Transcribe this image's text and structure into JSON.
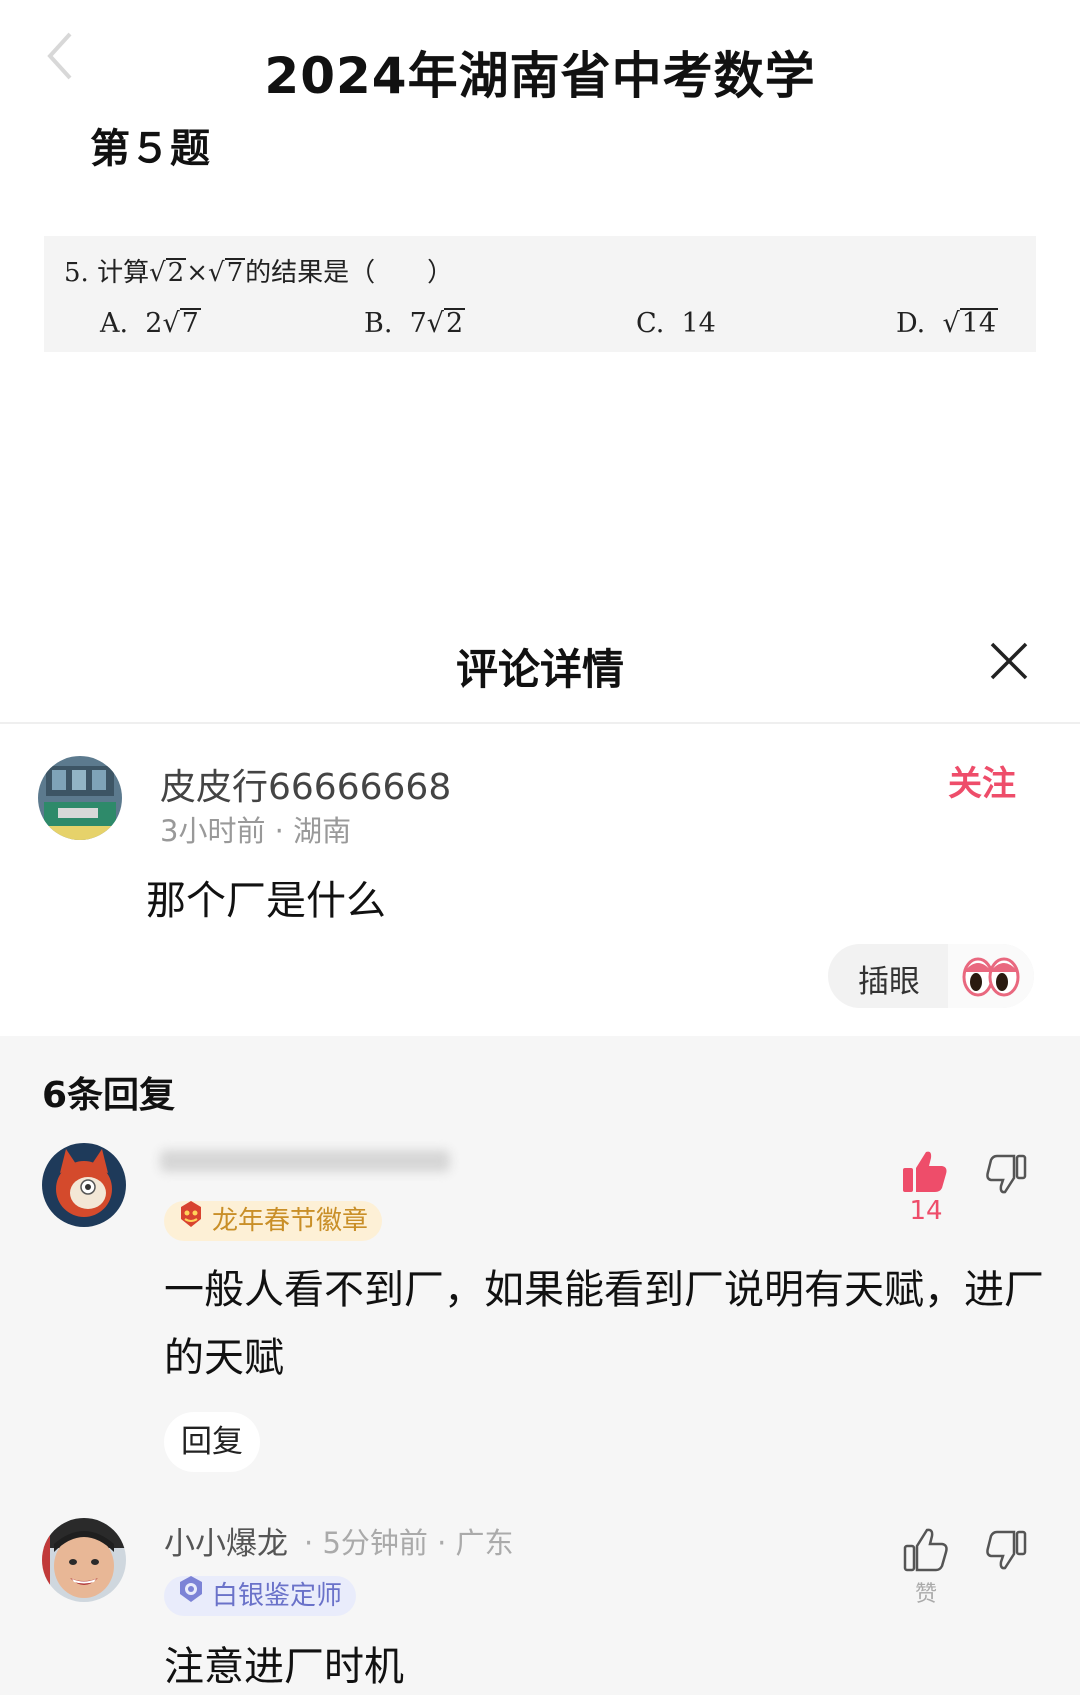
{
  "header": {
    "title": "2024年湖南省中考数学",
    "question_label": "第５题"
  },
  "question": {
    "stem_prefix": "5.  计算",
    "radicand_a": "2",
    "times": "×",
    "radicand_b": "7",
    "stem_suffix": "的结果是（　　）",
    "options": [
      {
        "letter": "A.",
        "coef": "2",
        "radicand": "7",
        "plain": ""
      },
      {
        "letter": "B.",
        "coef": "7",
        "radicand": "2",
        "plain": ""
      },
      {
        "letter": "C.",
        "coef": "",
        "radicand": "",
        "plain": "14"
      },
      {
        "letter": "D.",
        "coef": "",
        "radicand": "14",
        "plain": ""
      }
    ]
  },
  "comment_sheet": {
    "title": "评论详情",
    "main_comment": {
      "username": "皮皮行66666668",
      "time": "3小时前",
      "location": "湖南",
      "text": "那个厂是什么",
      "follow_label": "关注",
      "poke_label": "插眼"
    },
    "reply_count_label": "6条回复",
    "replies": [
      {
        "username": "",
        "badge": "龙年春节徽章",
        "text": "一般人看不到厂，如果能看到厂说明有天赋，进厂的天赋",
        "likes": "14",
        "reply_label": "回复"
      },
      {
        "username": "小小爆龙",
        "time": "5分钟前",
        "location": "广东",
        "badge": "白银鉴定师",
        "text": "注意进厂时机",
        "like_label": "赞"
      }
    ]
  },
  "colors": {
    "accent": "#ee4d6a",
    "reply_bg": "#f6f6f6",
    "gold_badge": "#c98f28",
    "silver_badge": "#6a72c9"
  },
  "icons": [
    "back-arrow-icon",
    "close-icon",
    "eyes-icon",
    "thumbs-up-icon",
    "thumbs-down-icon",
    "dragon-badge-icon",
    "appraiser-badge-icon"
  ]
}
